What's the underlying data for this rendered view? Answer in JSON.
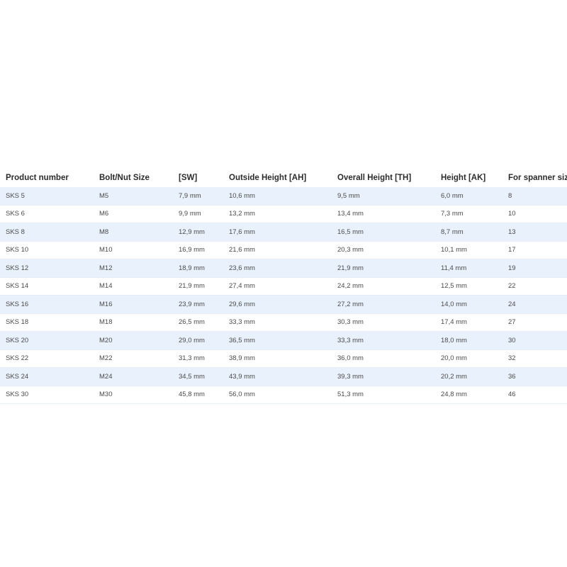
{
  "table": {
    "headers": [
      "Product number",
      "Bolt/Nut Size",
      "[SW]",
      "Outside Height [AH]",
      "Overall Height [TH]",
      "Height [AK]",
      "For spanner size"
    ],
    "rows": [
      [
        "SKS 5",
        "M5",
        "7,9 mm",
        "10,6 mm",
        "9,5 mm",
        "6,0 mm",
        "8"
      ],
      [
        "SKS 6",
        "M6",
        "9,9 mm",
        "13,2  mm",
        "13,4 mm",
        "7,3 mm",
        "10"
      ],
      [
        "SKS 8",
        "M8",
        "12,9 mm",
        "17,6 mm",
        "16,5 mm",
        "8,7 mm",
        "13"
      ],
      [
        "SKS 10",
        "M10",
        "16,9 mm",
        "21,6 mm",
        "20,3 mm",
        "10,1 mm",
        "17"
      ],
      [
        "SKS 12",
        "M12",
        "18,9 mm",
        "23,6 mm",
        "21,9 mm",
        "11,4 mm",
        "19"
      ],
      [
        "SKS 14",
        "M14",
        "21,9 mm",
        "27,4 mm",
        "24,2 mm",
        "12,5 mm",
        "22"
      ],
      [
        "SKS 16",
        "M16",
        "23,9 mm",
        "29,6 mm",
        "27,2 mm",
        "14,0 mm",
        "24"
      ],
      [
        "SKS 18",
        "M18",
        "26,5 mm",
        "33,3 mm",
        "30,3 mm",
        "17,4 mm",
        "27"
      ],
      [
        "SKS 20",
        "M20",
        "29,0  mm",
        "36,5 mm",
        "33,3 mm",
        "18,0 mm",
        "30"
      ],
      [
        "SKS 22",
        "M22",
        "31,3 mm",
        "38,9 mm",
        "36,0 mm",
        "20,0 mm",
        "32"
      ],
      [
        "SKS 24",
        "M24",
        "34,5 mm",
        "43,9 mm",
        "39,3 mm",
        "20,2 mm",
        "36"
      ],
      [
        "SKS 30",
        "M30",
        "45,8 mm",
        "56,0 mm",
        "51,3 mm",
        "24,8 mm",
        "46"
      ]
    ]
  },
  "colors": {
    "stripe": "#e9f2fc",
    "background": "#ffffff"
  }
}
